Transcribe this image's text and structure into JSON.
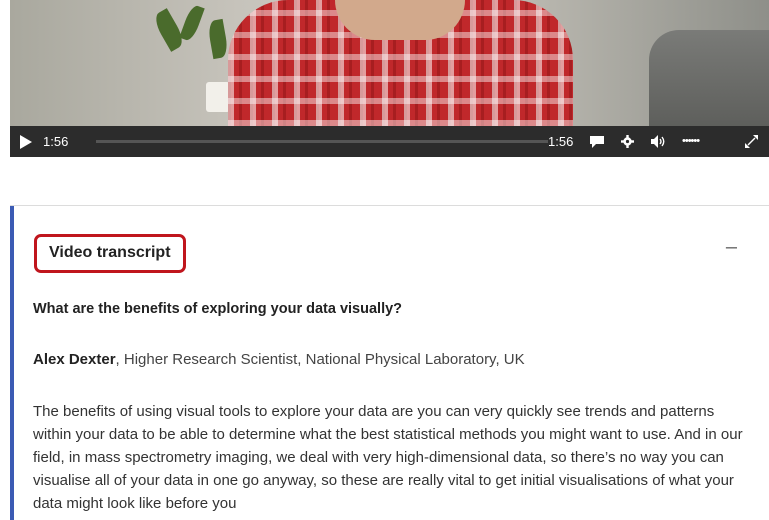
{
  "video": {
    "elapsed": "1:56",
    "duration": "1:56",
    "progress_fraction": 0.0,
    "volume_indicator": "••••••",
    "icons": [
      "play-icon",
      "captions-icon",
      "settings-gear-icon",
      "volume-icon",
      "fullscreen-icon"
    ]
  },
  "transcript": {
    "heading": "Video transcript",
    "collapse_label": "–",
    "question": "What are the benefits of exploring your data visually?",
    "speaker_name": "Alex Dexter",
    "speaker_role": ", Higher Research Scientist, National Physical Laboratory, UK",
    "body": "The benefits of using visual tools to explore your data are you can very quickly see trends and patterns within your data to be able to determine what the best statistical methods you might want to use. And in our field, in mass spectrometry imaging, we deal with very high-dimensional data, so there’s no way you can visualise all of your data in one go anyway, so these are really vital to get initial visualisations of what your data might look like before you"
  },
  "colors": {
    "accent_border": "#3b5bb4",
    "highlight_box": "#c0151d",
    "control_bar": "#2c2c2c"
  }
}
